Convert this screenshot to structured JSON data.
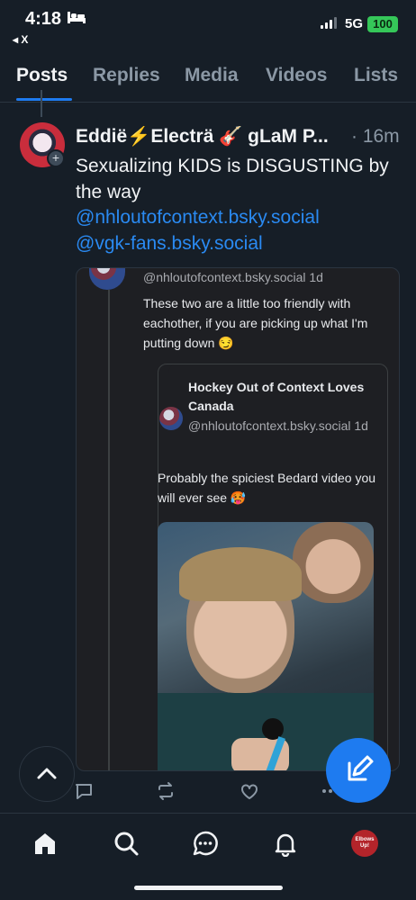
{
  "status_bar": {
    "time": "4:18",
    "back_label": "◂ X",
    "network": "5G",
    "battery": "100"
  },
  "tabs": [
    {
      "label": "Posts",
      "active": true
    },
    {
      "label": "Replies",
      "active": false
    },
    {
      "label": "Media",
      "active": false
    },
    {
      "label": "Videos",
      "active": false
    },
    {
      "label": "Lists",
      "active": false
    }
  ],
  "post": {
    "author": "Eddië⚡Electrä 🎸 gLaM P...",
    "time": "· 16m",
    "text": "Sexualizing KIDS is DISGUSTING by the way",
    "mentions": [
      "@nhloutofcontext.bsky.social",
      "@vgk-fans.bsky.social"
    ]
  },
  "quote": {
    "handle_time": "@nhloutofcontext.bsky.social 1d",
    "text": "These two are a little too friendly with eachother, if you are picking up what I'm putting down 😏",
    "inner": {
      "name": "Hockey Out of Context Loves Canada",
      "handle_time": "@nhloutofcontext.bsky.social 1d",
      "text": "Probably the spiciest Bedard video you will ever see 🥵"
    }
  },
  "nav": {
    "avatar_label": "Elbows Up!"
  },
  "colors": {
    "background": "#161e27",
    "accent": "#1e7bf0",
    "link": "#2a8af2",
    "muted": "#8b98a5",
    "battery": "#35c759"
  },
  "icons": [
    "bed-icon",
    "signal-icon",
    "plus-icon",
    "reply-icon",
    "repost-icon",
    "like-icon",
    "more-icon",
    "chevron-up-icon",
    "compose-icon",
    "home-icon",
    "search-icon",
    "chat-icon",
    "bell-icon"
  ]
}
